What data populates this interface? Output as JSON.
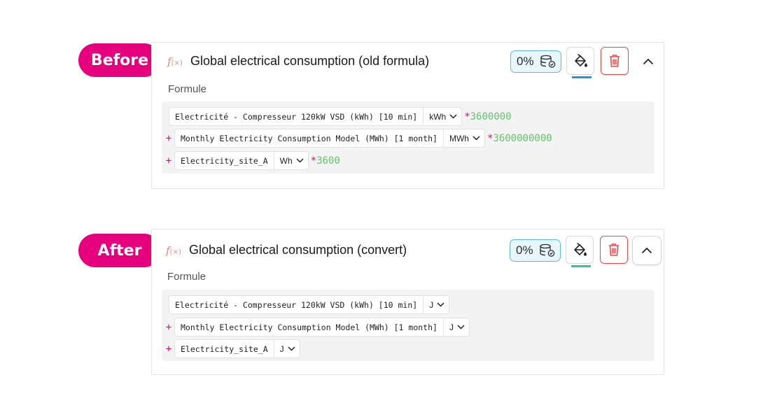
{
  "labels": {
    "before": "Before",
    "after": "After"
  },
  "before_card": {
    "fx_icon": "fx-icon",
    "title": "Global electrical consumption (old formula)",
    "percent": "0%",
    "bucket_color": "#1a9ad6",
    "formule_label": "Formule",
    "rows": [
      {
        "plus": "",
        "name": "Electricité - Compresseur 120kW VSD (kWh) [10 min]",
        "unit": "kWh",
        "multiplier": "3600000"
      },
      {
        "plus": "+",
        "name": "Monthly Electricity Consumption Model (MWh) [1 month]",
        "unit": "MWh",
        "multiplier": "3600000000"
      },
      {
        "plus": "+",
        "name": "Electricity_site_A",
        "unit": "Wh",
        "multiplier": "3600"
      }
    ]
  },
  "after_card": {
    "fx_icon": "fx-icon",
    "title": "Global electrical consumption (convert)",
    "percent": "0%",
    "bucket_color": "#2cc79a",
    "formule_label": "Formule",
    "rows": [
      {
        "plus": "",
        "name": "Electricité - Compresseur 120kW VSD (kWh) [10 min]",
        "unit": "J"
      },
      {
        "plus": "+",
        "name": "Monthly Electricity Consumption Model (MWh) [1 month]",
        "unit": "J"
      },
      {
        "plus": "+",
        "name": "Electricity_site_A",
        "unit": "J"
      }
    ]
  },
  "colors": {
    "accent_pink": "#e6007e",
    "multiplier_green": "#63c16e",
    "delete_red": "#e84a4a"
  }
}
